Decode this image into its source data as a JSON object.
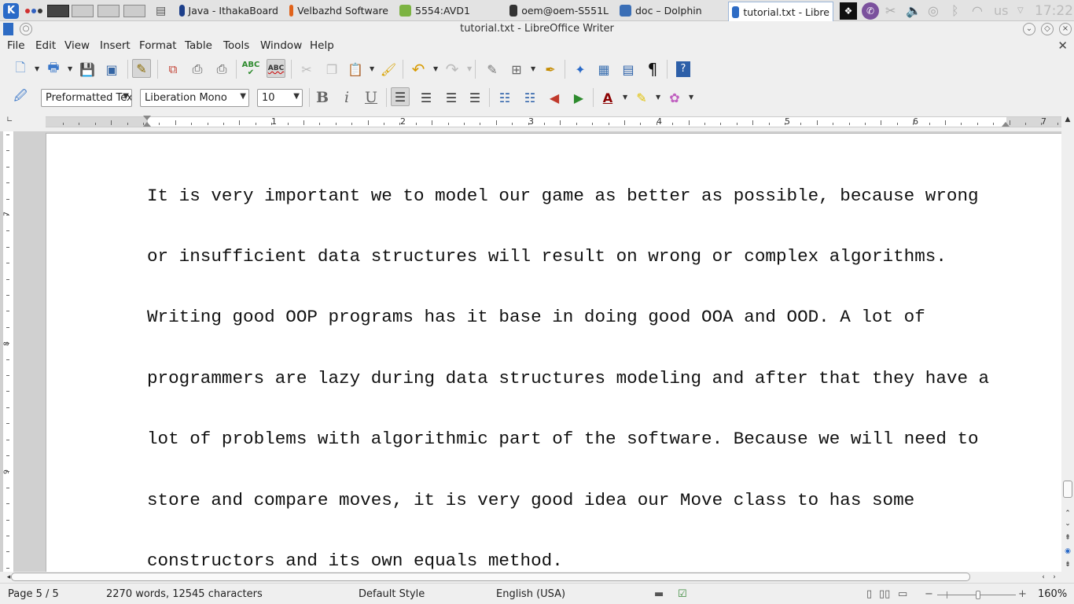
{
  "taskbar": {
    "tasks": [
      {
        "label": "Java - IthakaBoard",
        "color": "#1d3f8a"
      },
      {
        "label": "Velbazhd Software",
        "color": "#e0621a"
      },
      {
        "label": "5554:AVD1",
        "color": "#7cb342"
      },
      {
        "label": "oem@oem-S551L",
        "color": "#333333"
      },
      {
        "label": "doc – Dolphin",
        "color": "#3b6fb6"
      },
      {
        "label": "tutorial.txt - Libre",
        "color": "#2d6bc4"
      }
    ],
    "keyboard_layout": "us",
    "clock": "17:22"
  },
  "window": {
    "title": "tutorial.txt - LibreOffice Writer"
  },
  "menu": {
    "items": [
      "File",
      "Edit",
      "View",
      "Insert",
      "Format",
      "Table",
      "Tools",
      "Window",
      "Help"
    ]
  },
  "formatting": {
    "paragraph_style": "Preformatted Text",
    "font_name": "Liberation Mono",
    "font_size": "10",
    "bold_glyph": "B",
    "italic_glyph": "i",
    "underline_glyph": "U"
  },
  "ruler": {
    "numbers": [
      "1",
      "2",
      "3",
      "4",
      "5",
      "6",
      "7"
    ],
    "vertical_numbers": [
      "7",
      "8",
      "9"
    ]
  },
  "document": {
    "lines": [
      "It is very important we to model our game as better as possible, because wrong",
      "or insufficient data structures will result on wrong or complex algorithms.",
      "Writing good OOP programs has it base in doing good OOA and OOD. A lot of",
      "programmers are lazy during data structures modeling and after that they have a",
      "lot of problems with algorithmic part of the software. Because we will need to",
      "store and compare moves, it is very good idea our Move class to has some",
      "constructors and its own equals method."
    ]
  },
  "status": {
    "page": "Page 5 / 5",
    "word_count": "2270 words, 12545 characters",
    "page_style": "Default Style",
    "language": "English (USA)",
    "zoom": "160%"
  }
}
